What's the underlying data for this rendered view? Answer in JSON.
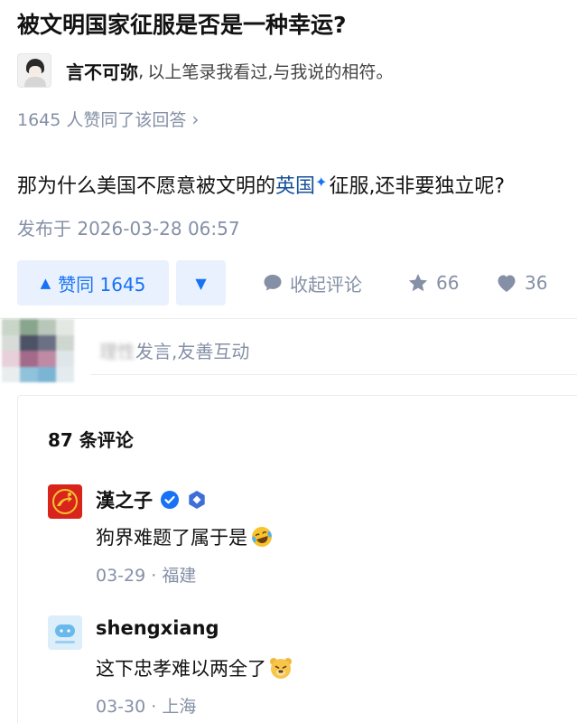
{
  "question": {
    "title": "被文明国家征服是否是一种幸运?"
  },
  "author": {
    "name": "言不可弥",
    "separator": ",",
    "bio": "以上笔录我看过,与我说的相符。"
  },
  "answer": {
    "votes_text": "1645 人赞同了该回答",
    "body_prefix": "那为什么美国不愿意被文明的",
    "body_link": "英国",
    "body_suffix": "征服,还非要独立呢?",
    "publish_time": "发布于 2026-03-28 06:57"
  },
  "actions": {
    "vote_up_label": "赞同 1645",
    "collapse_comments_label": "收起评论",
    "favorites_count": "66",
    "likes_count": "36"
  },
  "comment_input": {
    "placeholder_blurred": "理性",
    "placeholder_rest": "发言,友善互动"
  },
  "comments": {
    "count_label": "87 条评论",
    "items": [
      {
        "author": "漢之子",
        "text": "狗界难题了属于是",
        "date": "03-29",
        "location": "福建",
        "meta_sep": " · "
      },
      {
        "author": "shengxiang",
        "text": "这下忠孝难以两全了",
        "date": "03-30",
        "location": "上海",
        "meta_sep": " · "
      }
    ]
  },
  "colors": {
    "brand_blue": "#1772f6",
    "link_blue": "#175199",
    "meta_grey": "#8590a6",
    "vote_bg": "#e9f1fe"
  }
}
